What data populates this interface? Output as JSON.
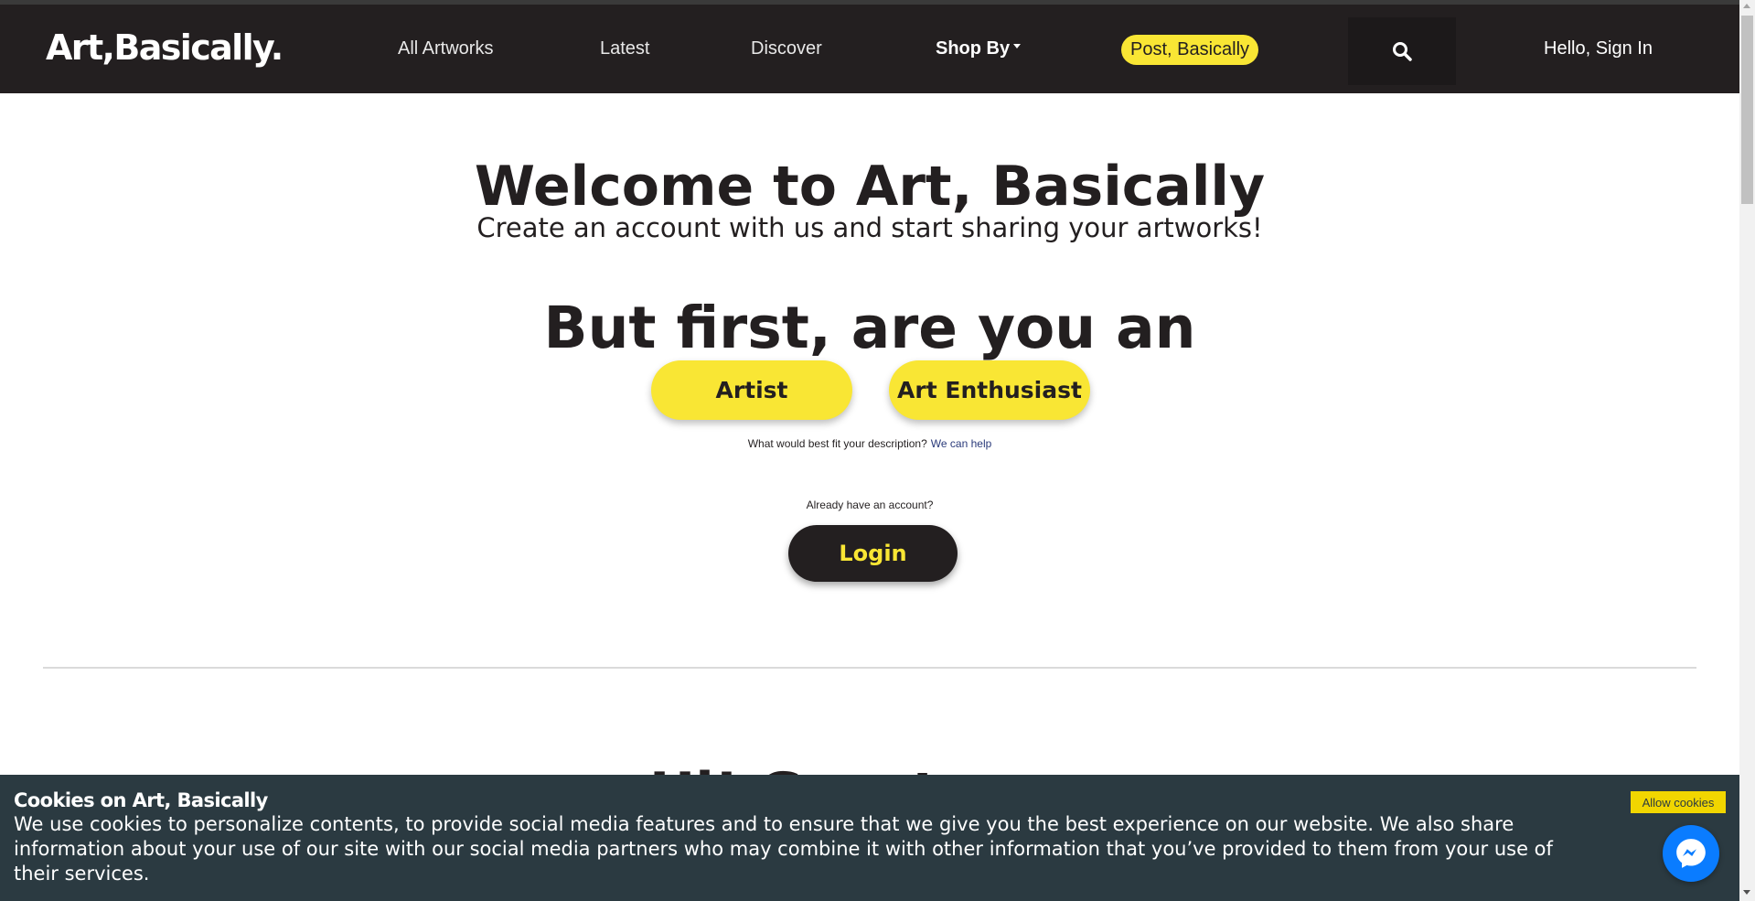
{
  "nav": {
    "brand": "Art,Basically.",
    "all_artworks": "All Artworks",
    "latest": "Latest",
    "discover": "Discover",
    "shop_by": "Shop By",
    "post": "Post, Basically",
    "search_icon": "search-icon",
    "signin": "Hello, Sign In"
  },
  "main": {
    "welcome": "Welcome to Art, Basically",
    "subtitle": "Create an account with us and start sharing your artworks!",
    "question": "But first, are you an",
    "artist_button": "Artist",
    "enthusiast_button": "Art Enthusiast",
    "hint_text": "What would best fit your description?",
    "hint_link": "We can help",
    "already": "Already have an account?",
    "login_button": "Login",
    "next_heading_partial": "Hi! Guest..."
  },
  "cookie": {
    "title": "Cookies on Art, Basically",
    "text": "We use cookies to personalize contents, to provide social media features and to ensure that we give you the best experience on our website. We also share information about your use of our site with our social media partners who may combine it with other information that you’ve provided to them from your use of their services.",
    "allow": "Allow cookies",
    "messenger_icon": "messenger-icon"
  },
  "colors": {
    "brand_dark": "#231f20",
    "accent_yellow": "#f9e634",
    "cookie_bg": "#2b3a41",
    "messenger_blue": "#0a7cff"
  }
}
